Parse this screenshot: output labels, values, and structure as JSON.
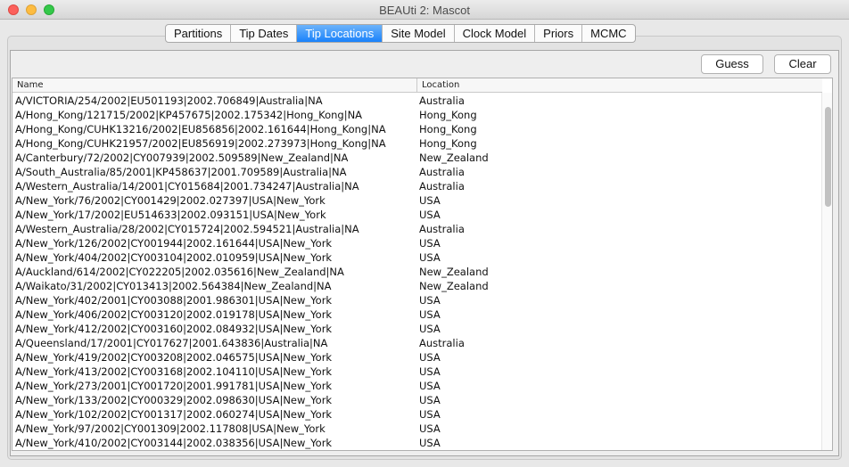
{
  "window": {
    "title": "BEAUti 2: Mascot"
  },
  "tabs": [
    {
      "label": "Partitions"
    },
    {
      "label": "Tip Dates"
    },
    {
      "label": "Tip Locations",
      "active": true
    },
    {
      "label": "Site Model"
    },
    {
      "label": "Clock Model"
    },
    {
      "label": "Priors"
    },
    {
      "label": "MCMC"
    }
  ],
  "buttons": {
    "guess": "Guess",
    "clear": "Clear"
  },
  "table": {
    "columns": {
      "name": "Name",
      "location": "Location"
    },
    "rows": [
      {
        "name": "A/VICTORIA/254/2002|EU501193|2002.706849|Australia|NA",
        "location": "Australia"
      },
      {
        "name": "A/Hong_Kong/121715/2002|KP457675|2002.175342|Hong_Kong|NA",
        "location": "Hong_Kong"
      },
      {
        "name": "A/Hong_Kong/CUHK13216/2002|EU856856|2002.161644|Hong_Kong|NA",
        "location": "Hong_Kong"
      },
      {
        "name": "A/Hong_Kong/CUHK21957/2002|EU856919|2002.273973|Hong_Kong|NA",
        "location": "Hong_Kong"
      },
      {
        "name": "A/Canterbury/72/2002|CY007939|2002.509589|New_Zealand|NA",
        "location": "New_Zealand"
      },
      {
        "name": "A/South_Australia/85/2001|KP458637|2001.709589|Australia|NA",
        "location": "Australia"
      },
      {
        "name": "A/Western_Australia/14/2001|CY015684|2001.734247|Australia|NA",
        "location": "Australia"
      },
      {
        "name": "A/New_York/76/2002|CY001429|2002.027397|USA|New_York",
        "location": "USA"
      },
      {
        "name": "A/New_York/17/2002|EU514633|2002.093151|USA|New_York",
        "location": "USA"
      },
      {
        "name": "A/Western_Australia/28/2002|CY015724|2002.594521|Australia|NA",
        "location": "Australia"
      },
      {
        "name": "A/New_York/126/2002|CY001944|2002.161644|USA|New_York",
        "location": "USA"
      },
      {
        "name": "A/New_York/404/2002|CY003104|2002.010959|USA|New_York",
        "location": "USA"
      },
      {
        "name": "A/Auckland/614/2002|CY022205|2002.035616|New_Zealand|NA",
        "location": "New_Zealand"
      },
      {
        "name": "A/Waikato/31/2002|CY013413|2002.564384|New_Zealand|NA",
        "location": "New_Zealand"
      },
      {
        "name": "A/New_York/402/2001|CY003088|2001.986301|USA|New_York",
        "location": "USA"
      },
      {
        "name": "A/New_York/406/2002|CY003120|2002.019178|USA|New_York",
        "location": "USA"
      },
      {
        "name": "A/New_York/412/2002|CY003160|2002.084932|USA|New_York",
        "location": "USA"
      },
      {
        "name": "A/Queensland/17/2001|CY017627|2001.643836|Australia|NA",
        "location": "Australia"
      },
      {
        "name": "A/New_York/419/2002|CY003208|2002.046575|USA|New_York",
        "location": "USA"
      },
      {
        "name": "A/New_York/413/2002|CY003168|2002.104110|USA|New_York",
        "location": "USA"
      },
      {
        "name": "A/New_York/273/2001|CY001720|2001.991781|USA|New_York",
        "location": "USA"
      },
      {
        "name": "A/New_York/133/2002|CY000329|2002.098630|USA|New_York",
        "location": "USA"
      },
      {
        "name": "A/New_York/102/2002|CY001317|2002.060274|USA|New_York",
        "location": "USA"
      },
      {
        "name": "A/New_York/97/2002|CY001309|2002.117808|USA|New_York",
        "location": "USA"
      },
      {
        "name": "A/New_York/410/2002|CY003144|2002.038356|USA|New_York",
        "location": "USA"
      }
    ]
  }
}
